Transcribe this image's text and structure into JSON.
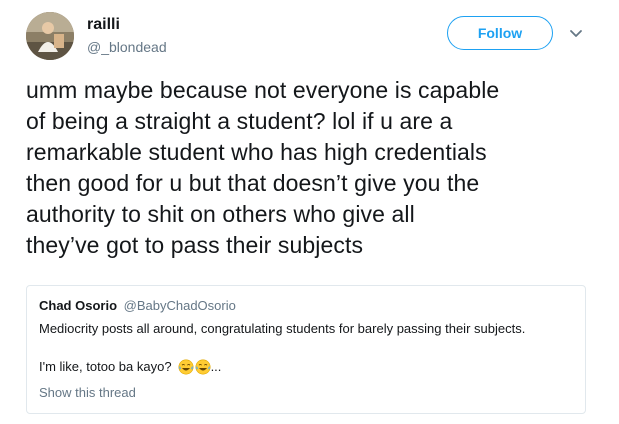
{
  "author": {
    "name": "railli",
    "handle": "@_blondead",
    "avatar_icon": "user-avatar-photo"
  },
  "follow_button": {
    "label": "Follow",
    "color": "#1da1f2"
  },
  "caret_icon": "chevron-down-icon",
  "tweet": {
    "text": "umm maybe because not everyone is capable\nof being a straight a student? lol if u are a\nremarkable student who has high credentials\nthen good for u but that doesn’t give you the\nauthority to shit on others who give all\nthey’ve got to pass their subjects"
  },
  "quoted_tweet": {
    "name": "Chad Osorio",
    "handle": "@BabyChadOsorio",
    "text_line1": "Mediocrity posts all around, congratulating students for barely passing their subjects.",
    "text_line2": "I'm like, totoo ba kayo?",
    "emoji_icon": "face-with-tears-of-joy-icon",
    "ellipsis": "...",
    "show_thread_label": "Show this thread"
  }
}
